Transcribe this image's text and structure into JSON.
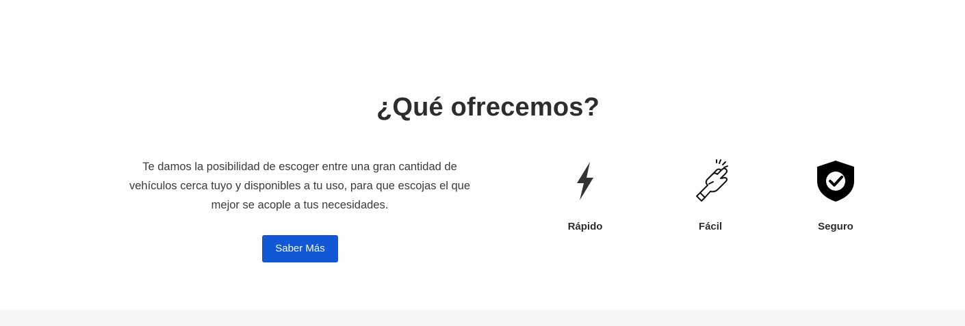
{
  "offer": {
    "title": "¿Qué ofrecemos?",
    "description": "Te damos la posibilidad de escoger entre una gran cantidad de vehículos cerca tuyo y disponibles a tu uso, para que escojas el que mejor se acople a tus necesidades.",
    "cta_label": "Saber Más",
    "cta_color": "#1257d6"
  },
  "features": [
    {
      "icon": "lightning-icon",
      "label": "Rápido"
    },
    {
      "icon": "snapping-hand-icon",
      "label": "Fácil"
    },
    {
      "icon": "shield-check-icon",
      "label": "Seguro"
    }
  ]
}
